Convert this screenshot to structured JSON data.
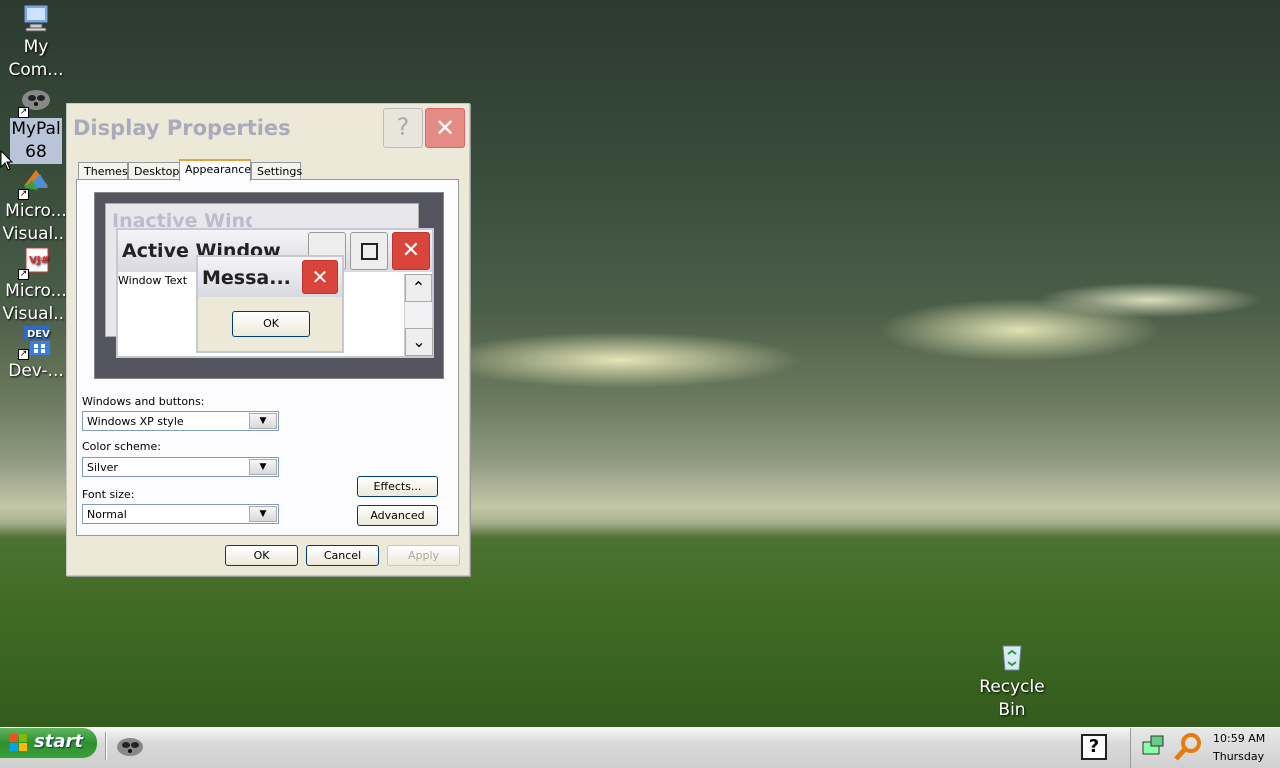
{
  "desktop": {
    "icons": [
      {
        "label": "My\nCom..."
      },
      {
        "label": "MyPal\n68"
      },
      {
        "label": "Micro...\nVisual..."
      },
      {
        "label": "Micro...\nVisual..."
      },
      {
        "label": "Dev-..."
      },
      {
        "label": "Recycle\nBin"
      }
    ]
  },
  "dialog": {
    "title": "Display Properties",
    "help_glyph": "?",
    "close_glyph": "✕",
    "tabs": [
      "Themes",
      "Desktop",
      "Appearance",
      "Settings"
    ],
    "active_tab": "Appearance",
    "preview": {
      "inactive_title": "Inactive Wind...",
      "active_title": "Active Window",
      "window_text": "Window Text",
      "message_title": "Messa...",
      "message_ok": "OK"
    },
    "windows_buttons_label": "Windows and buttons:",
    "windows_buttons_value": "Windows XP style",
    "color_scheme_label": "Color scheme:",
    "color_scheme_value": "Silver",
    "font_size_label": "Font size:",
    "font_size_value": "Normal",
    "effects_label": "Effects...",
    "advanced_label": "Advanced",
    "ok_label": "OK",
    "cancel_label": "Cancel",
    "apply_label": "Apply"
  },
  "taskbar": {
    "start_label": "start",
    "clock_time": "10:59 AM",
    "clock_day": "Thursday"
  },
  "colors": {
    "close_red": "#d9453a",
    "start_green": "#3aa13a",
    "tab_accent": "#e6a23c"
  }
}
